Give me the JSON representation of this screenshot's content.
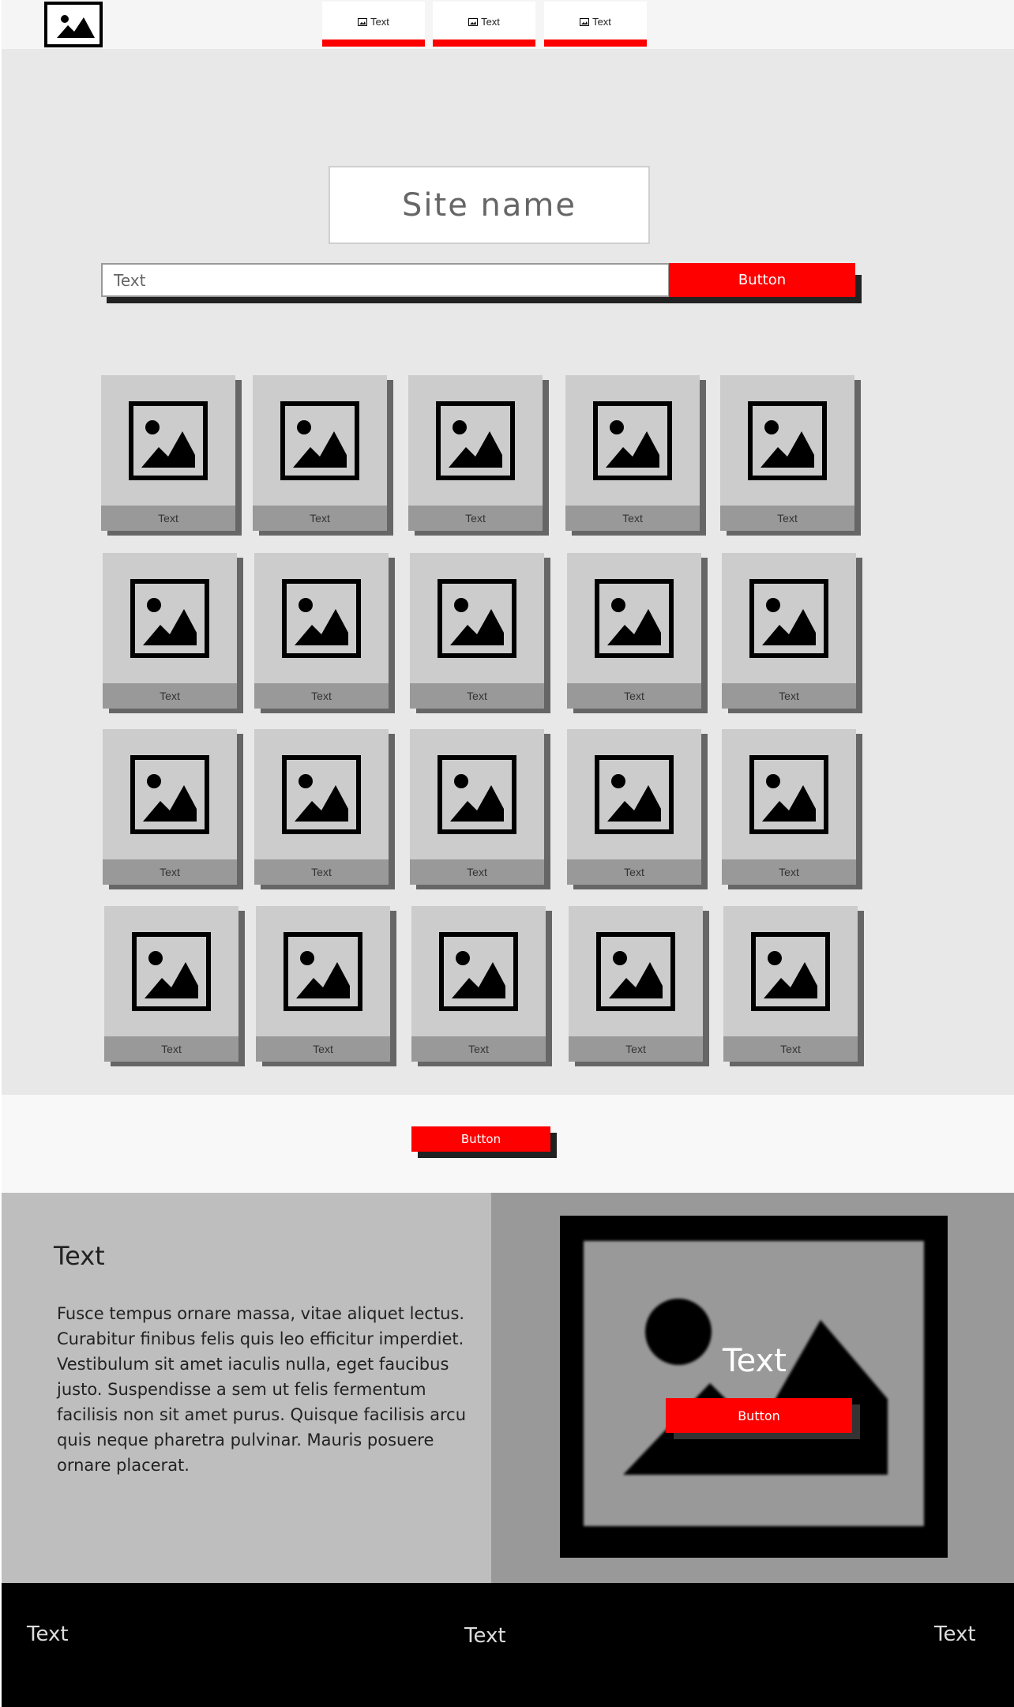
{
  "header": {
    "nav": [
      {
        "icon": "image-icon",
        "label": "Text"
      },
      {
        "icon": "image-icon",
        "label": "Text"
      },
      {
        "icon": "image-icon",
        "label": "Text"
      }
    ]
  },
  "hero": {
    "site_name": "Site name",
    "search": {
      "placeholder": "Text",
      "button_label": "Button"
    }
  },
  "gallery": {
    "labels": [
      "Text",
      "Text",
      "Text",
      "Text",
      "Text",
      "Text",
      "Text",
      "Text",
      "Text",
      "Text",
      "Text",
      "Text",
      "Text",
      "Text",
      "Text",
      "Text",
      "Text",
      "Text",
      "Text",
      "Text"
    ]
  },
  "load_more": {
    "button_label": "Button"
  },
  "feature": {
    "title": "Text",
    "body": "Fusce tempus ornare massa, vitae aliquet lectus. Curabitur finibus felis quis leo efficitur imperdiet. Vestibulum sit amet iaculis nulla, eget faucibus justo. Suspendisse a sem ut felis fermentum facilisis non sit amet purus. Quisque facilisis arcu quis neque pharetra pulvinar. Mauris posuere ornare placerat.",
    "overlay_text": "Text",
    "button_label": "Button"
  },
  "footer": {
    "left": "Text",
    "center": "Text",
    "right": "Text"
  },
  "colors": {
    "accent": "#ff0000",
    "footer": "#000000",
    "card": "#cccccc",
    "card_label": "#999999"
  }
}
